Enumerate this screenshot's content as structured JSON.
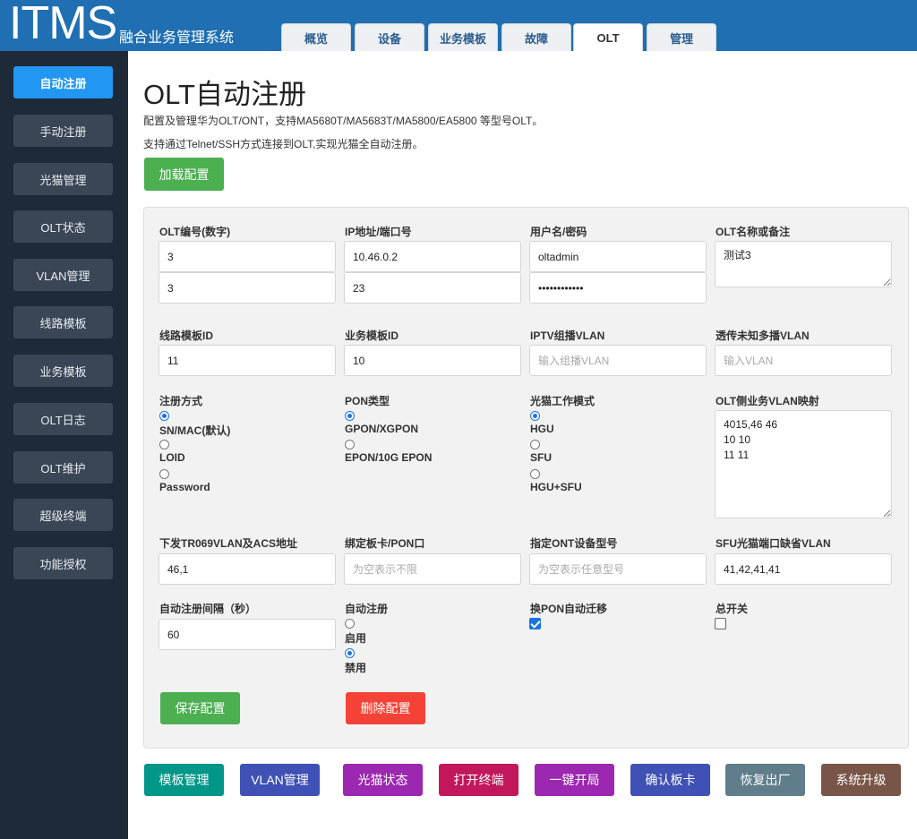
{
  "header": {
    "logo": "ITMS",
    "subtitle": "融合业务管理系统",
    "tabs": [
      "概览",
      "设备",
      "业务模板",
      "故障",
      "OLT",
      "管理"
    ],
    "active_tab": "OLT"
  },
  "sidebar": {
    "items": [
      "自动注册",
      "手动注册",
      "光猫管理",
      "OLT状态",
      "VLAN管理",
      "线路模板",
      "业务模板",
      "OLT日志",
      "OLT维护",
      "超级终端",
      "功能授权"
    ],
    "active": "自动注册"
  },
  "main": {
    "title": "OLT自动注册",
    "desc1": "配置及管理华为OLT/ONT，支持MA5680T/MA5683T/MA5800/EA5800 等型号OLT。",
    "desc2": "支持通过Telnet/SSH方式连接到OLT,实现光猫全自动注册。",
    "load_button": "加载配置"
  },
  "form": {
    "olt_no": {
      "label": "OLT编号(数字)",
      "value1": "3",
      "value2": "3"
    },
    "ip_port": {
      "label": "IP地址/端口号",
      "ip": "10.46.0.2",
      "port": "23"
    },
    "user_pass": {
      "label": "用户名/密码",
      "user": "oltadmin",
      "password": "••••••••••••"
    },
    "olt_name": {
      "label": "OLT名称或备注",
      "value": "测试3"
    },
    "line_template": {
      "label": "线路模板ID",
      "value": "11"
    },
    "service_template": {
      "label": "业务模板ID",
      "value": "10"
    },
    "iptv_vlan": {
      "label": "IPTV组播VLAN",
      "placeholder": "输入组播VLAN"
    },
    "unknown_multicast": {
      "label": "透传未知多播VLAN",
      "placeholder": "输入VLAN"
    },
    "reg_mode": {
      "label": "注册方式",
      "options": [
        "SN/MAC(默认)",
        "LOID",
        "Password"
      ]
    },
    "pon_type": {
      "label": "PON类型",
      "options": [
        "GPON/XGPON",
        "EPON/10G EPON"
      ]
    },
    "ont_mode": {
      "label": "光猫工作模式",
      "options": [
        "HGU",
        "SFU",
        "HGU+SFU"
      ]
    },
    "vlan_map": {
      "label": "OLT侧业务VLAN映射",
      "value": "4015,46 46\n10 10\n11 11"
    },
    "tr069": {
      "label": "下发TR069VLAN及ACS地址",
      "value": "46,1"
    },
    "bind_board": {
      "label": "绑定板卡/PON口",
      "placeholder": "为空表示不限"
    },
    "ont_model": {
      "label": "指定ONT设备型号",
      "placeholder": "为空表示任意型号"
    },
    "sfu_vlan": {
      "label": "SFU光猫端口缺省VLAN",
      "value": "41,42,41,41"
    },
    "interval": {
      "label": "自动注册间隔（秒）",
      "value": "60"
    },
    "auto_reg": {
      "label": "自动注册",
      "options": [
        "启用",
        "禁用"
      ]
    },
    "pon_migrate": {
      "label": "换PON自动迁移",
      "checked": true
    },
    "master_switch": {
      "label": "总开关",
      "checked": false
    },
    "save_button": "保存配置",
    "delete_button": "删除配置"
  },
  "bottom_buttons": [
    {
      "label": "模板管理",
      "color": "#009688"
    },
    {
      "label": "VLAN管理",
      "color": "#3f51b5"
    },
    {
      "label": "光猫状态",
      "color": "#9c27b0"
    },
    {
      "label": "打开终端",
      "color": "#c2185b"
    },
    {
      "label": "一键开局",
      "color": "#9c27b0"
    },
    {
      "label": "确认板卡",
      "color": "#3f51b5"
    },
    {
      "label": "恢复出厂",
      "color": "#607d8b"
    },
    {
      "label": "系统升级",
      "color": "#795548"
    }
  ]
}
